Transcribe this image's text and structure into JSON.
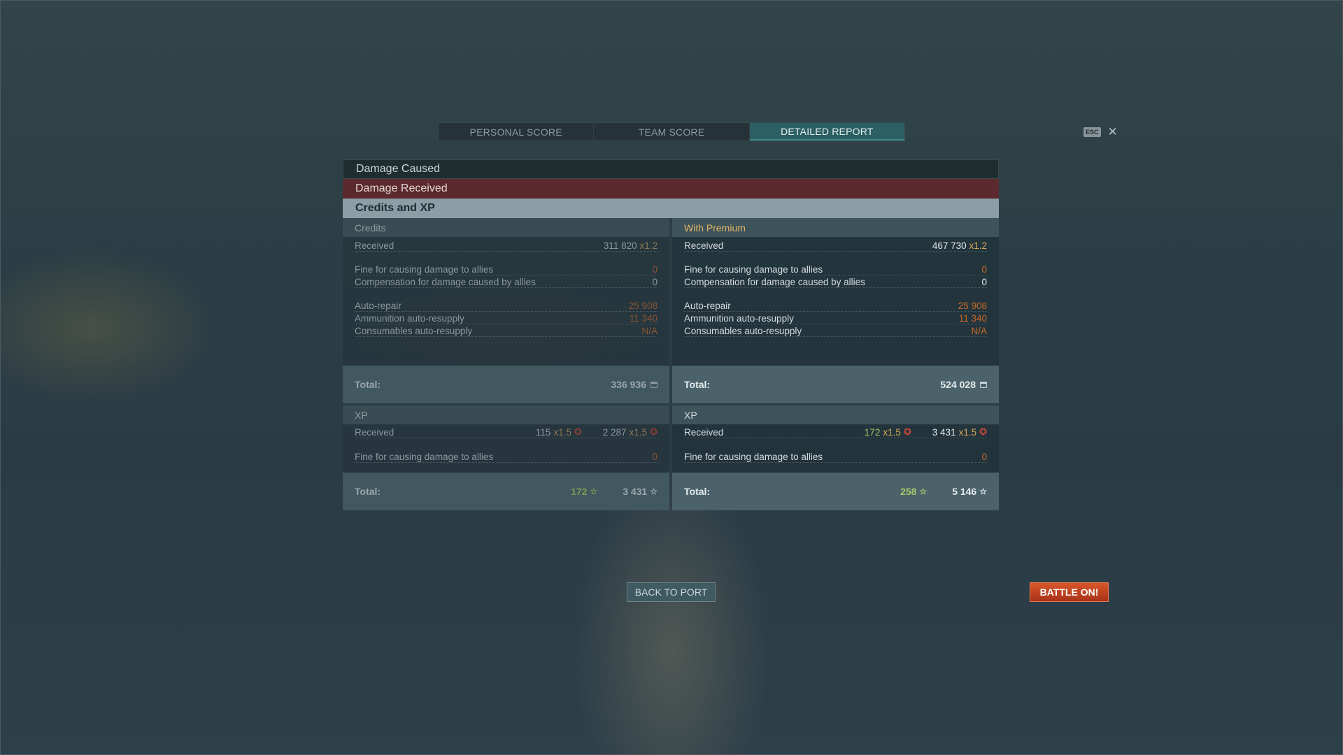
{
  "tabs": {
    "personal": "PERSONAL SCORE",
    "team": "TEAM SCORE",
    "detailed": "DETAILED REPORT"
  },
  "esc_label": "ESC",
  "close_glyph": "✕",
  "sections": {
    "damage_caused": "Damage Caused",
    "damage_received": "Damage Received",
    "credits_xp": "Credits and XP"
  },
  "credits": {
    "left": {
      "header": "Credits",
      "received_label": "Received",
      "received_value": "311 820",
      "received_mult": "x1.2",
      "fine_label": "Fine for causing damage to allies",
      "fine_value": "0",
      "comp_label": "Compensation for damage caused by allies",
      "comp_value": "0",
      "autorepair_label": "Auto-repair",
      "autorepair_value": "25 908",
      "ammo_label": "Ammunition auto-resupply",
      "ammo_value": "11 340",
      "consum_label": "Consumables auto-resupply",
      "consum_value": "N/A",
      "total_label": "Total:",
      "total_value": "336 936"
    },
    "right": {
      "header": "With Premium",
      "received_label": "Received",
      "received_value": "467 730",
      "received_mult": "x1.2",
      "fine_label": "Fine for causing damage to allies",
      "fine_value": "0",
      "comp_label": "Compensation for damage caused by allies",
      "comp_value": "0",
      "autorepair_label": "Auto-repair",
      "autorepair_value": "25 908",
      "ammo_label": "Ammunition auto-resupply",
      "ammo_value": "11 340",
      "consum_label": "Consumables auto-resupply",
      "consum_value": "N/A",
      "total_label": "Total:",
      "total_value": "524 028"
    }
  },
  "xp": {
    "left": {
      "header": "XP",
      "received_label": "Received",
      "received_xp": "115",
      "received_xp_mult": "x1.5",
      "received_free": "2 287",
      "received_free_mult": "x1.5",
      "fine_label": "Fine for causing damage to allies",
      "fine_value": "0",
      "total_label": "Total:",
      "total_xp": "172",
      "total_free": "3 431"
    },
    "right": {
      "header": "XP",
      "received_label": "Received",
      "received_xp": "172",
      "received_xp_mult": "x1.5",
      "received_free": "3 431",
      "received_free_mult": "x1.5",
      "fine_label": "Fine for causing damage to allies",
      "fine_value": "0",
      "total_label": "Total:",
      "total_xp": "258",
      "total_free": "5 146"
    }
  },
  "icons": {
    "star": "☆",
    "star_badge": "✪"
  },
  "buttons": {
    "back_to_port": "BACK TO PORT",
    "battle_on": "BATTLE ON!"
  }
}
